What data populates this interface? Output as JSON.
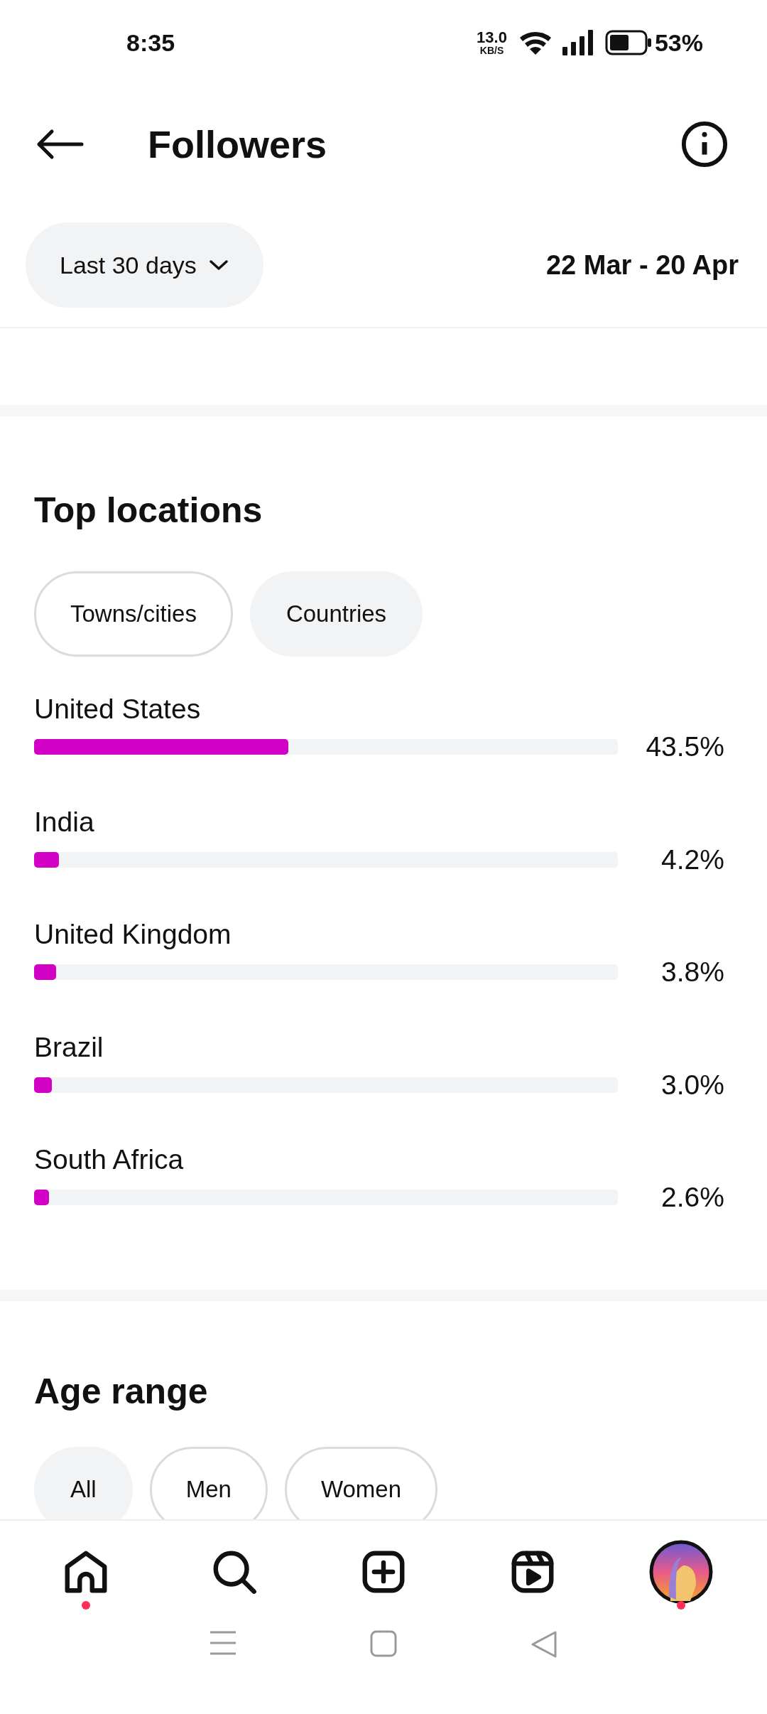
{
  "status_bar": {
    "time": "8:35",
    "speed": "13.0",
    "speed_unit": "KB/S",
    "battery": "53%"
  },
  "header": {
    "title": "Followers"
  },
  "period": {
    "label": "Last 30 days",
    "range": "22 Mar - 20 Apr"
  },
  "top_locations": {
    "title": "Top locations",
    "filters": [
      {
        "label": "Towns/cities",
        "selected": false
      },
      {
        "label": "Countries",
        "selected": true
      }
    ],
    "rows": [
      {
        "name": "United States",
        "level": 0.435,
        "value": "43.5%"
      },
      {
        "name": "India",
        "level": 0.042,
        "value": "4.2%"
      },
      {
        "name": "United Kingdom",
        "level": 0.038,
        "value": "3.8%"
      },
      {
        "name": "Brazil",
        "level": 0.03,
        "value": "3.0%"
      },
      {
        "name": "South Africa",
        "level": 0.026,
        "value": "2.6%"
      }
    ]
  },
  "age_range": {
    "title": "Age range",
    "filters": [
      {
        "label": "All",
        "selected": true
      },
      {
        "label": "Men",
        "selected": false
      },
      {
        "label": "Women",
        "selected": false
      }
    ]
  },
  "bottom_nav": [
    {
      "kind": "home",
      "badge": true
    },
    {
      "kind": "search",
      "badge": false
    },
    {
      "kind": "create",
      "badge": false
    },
    {
      "kind": "reels",
      "badge": false
    },
    {
      "kind": "profile",
      "badge": true
    }
  ]
}
